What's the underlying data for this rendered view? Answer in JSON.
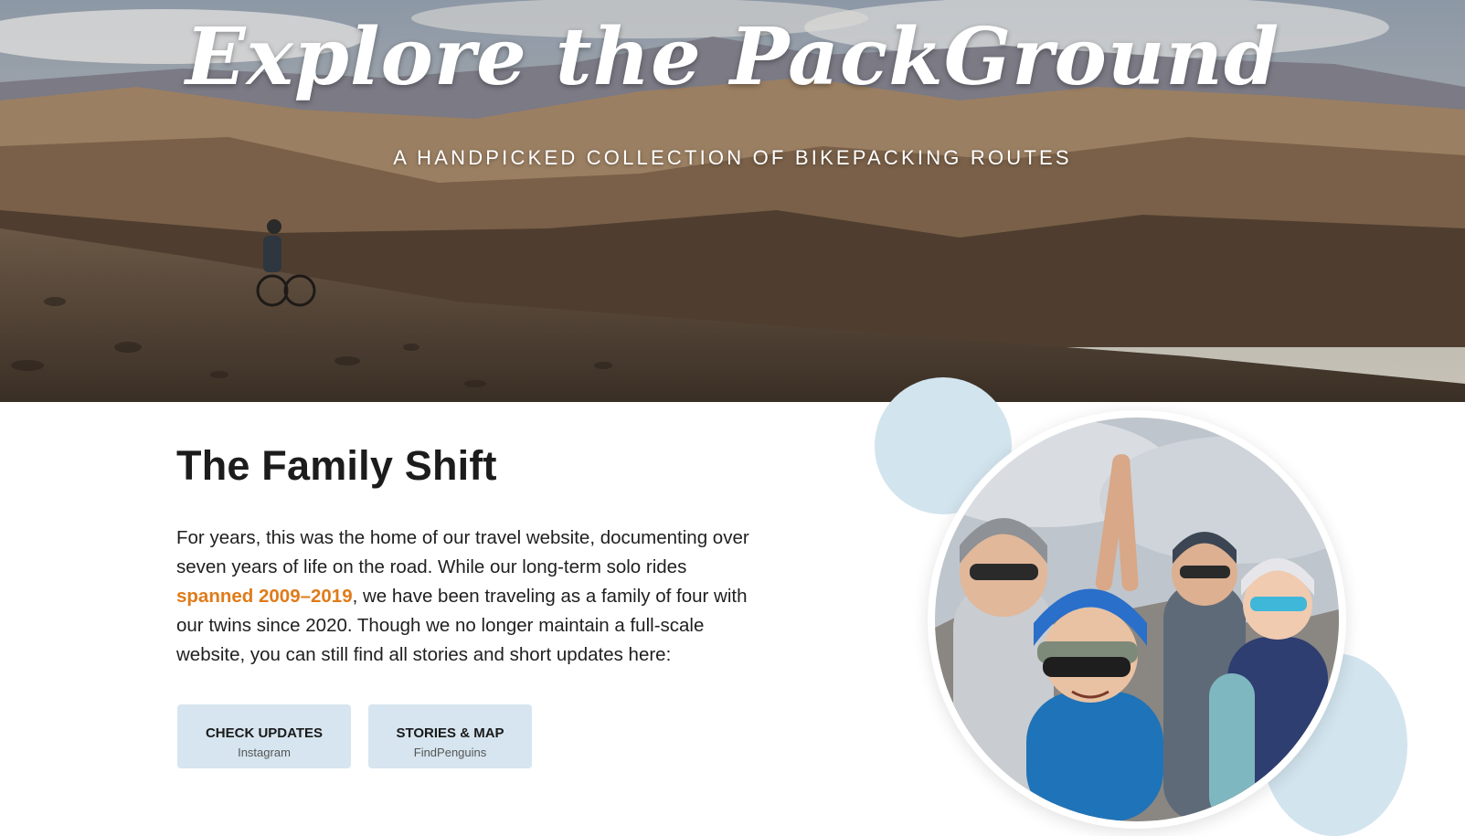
{
  "hero": {
    "title": "Explore the PackGround",
    "subtitle": "A HANDPICKED COLLECTION OF BIKEPACKING ROUTES"
  },
  "section": {
    "title": "The Family Shift",
    "intro_before": "For years, this was the home of our travel website, documenting over seven years of life on the road. While our long-term solo rides ",
    "intro_highlight": "spanned 2009–2019",
    "intro_after": ", we have been traveling as a family of four with our twins since 2020. Though we no longer maintain a full-scale website, you can still find all stories and short updates here:"
  },
  "buttons": [
    {
      "label": "CHECK UPDATES",
      "sub": "Instagram"
    },
    {
      "label": "STORIES & MAP",
      "sub": "FindPenguins"
    }
  ],
  "colors": {
    "accent": "#e07b1a",
    "button_bg": "#d6e5ef",
    "deco_circle": "#d2e4ee"
  },
  "icons": {
    "hero_image": "bikepacker-mountain-landscape",
    "family_photo": "family-selfie-helmets"
  }
}
